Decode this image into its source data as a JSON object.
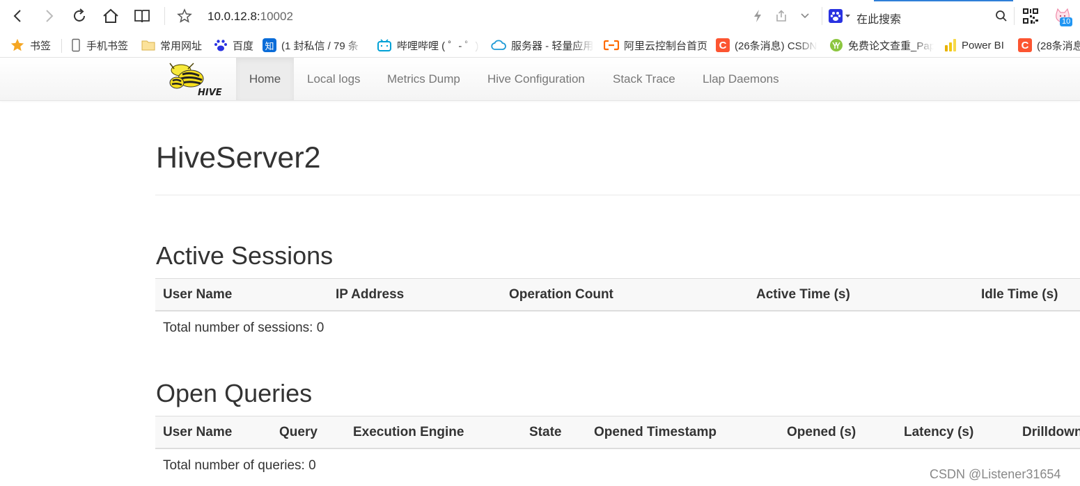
{
  "browser": {
    "url_host": "10.0.12.8:",
    "url_port": "10002",
    "search_label": "在此搜索",
    "badge_count": "10"
  },
  "bookmarks": [
    {
      "label": "书签",
      "icon": "star-icon"
    },
    {
      "label": "手机书签",
      "icon": "phone-icon"
    },
    {
      "label": "常用网址",
      "icon": "folder-icon"
    },
    {
      "label": "百度",
      "icon": "baidu-paw-icon"
    },
    {
      "label": "(1 封私信 / 79 条",
      "icon": "zhihu-icon",
      "icon_text": "知"
    },
    {
      "label": "哔哩哔哩 ( ゜- ゜)つ",
      "icon": "bilibili-icon"
    },
    {
      "label": "服务器 - 轻量应用",
      "icon": "cloud-icon"
    },
    {
      "label": "阿里云控制台首页",
      "icon": "aliyun-icon"
    },
    {
      "label": "(26条消息) CSDN",
      "icon": "csdn-icon",
      "icon_text": "C"
    },
    {
      "label": "免费论文查重_Pap",
      "icon": "paperyy-icon"
    },
    {
      "label": "Power BI",
      "icon": "powerbi-icon"
    },
    {
      "label": "(28条消息",
      "icon": "csdn-icon",
      "icon_text": "C"
    }
  ],
  "nav": {
    "items": [
      {
        "label": "Home"
      },
      {
        "label": "Local logs"
      },
      {
        "label": "Metrics Dump"
      },
      {
        "label": "Hive Configuration"
      },
      {
        "label": "Stack Trace"
      },
      {
        "label": "Llap Daemons"
      }
    ],
    "logo_text": "HIVE"
  },
  "page": {
    "title": "HiveServer2"
  },
  "sessions": {
    "title": "Active Sessions",
    "columns": [
      "User Name",
      "IP Address",
      "Operation Count",
      "Active Time (s)",
      "Idle Time (s)"
    ],
    "total": "Total number of sessions: 0"
  },
  "queries": {
    "title": "Open Queries",
    "columns": [
      "User Name",
      "Query",
      "Execution Engine",
      "State",
      "Opened Timestamp",
      "Opened (s)",
      "Latency (s)",
      "Drilldown"
    ],
    "total": "Total number of queries: 0"
  },
  "watermark": "CSDN @Listener31654",
  "colors": {
    "csdn_red": "#fc5531",
    "zhihu_blue": "#0a6cd8",
    "bilibili_blue": "#00a1d6",
    "aliyun_orange": "#ff6a00",
    "link_gray": "#777777"
  }
}
